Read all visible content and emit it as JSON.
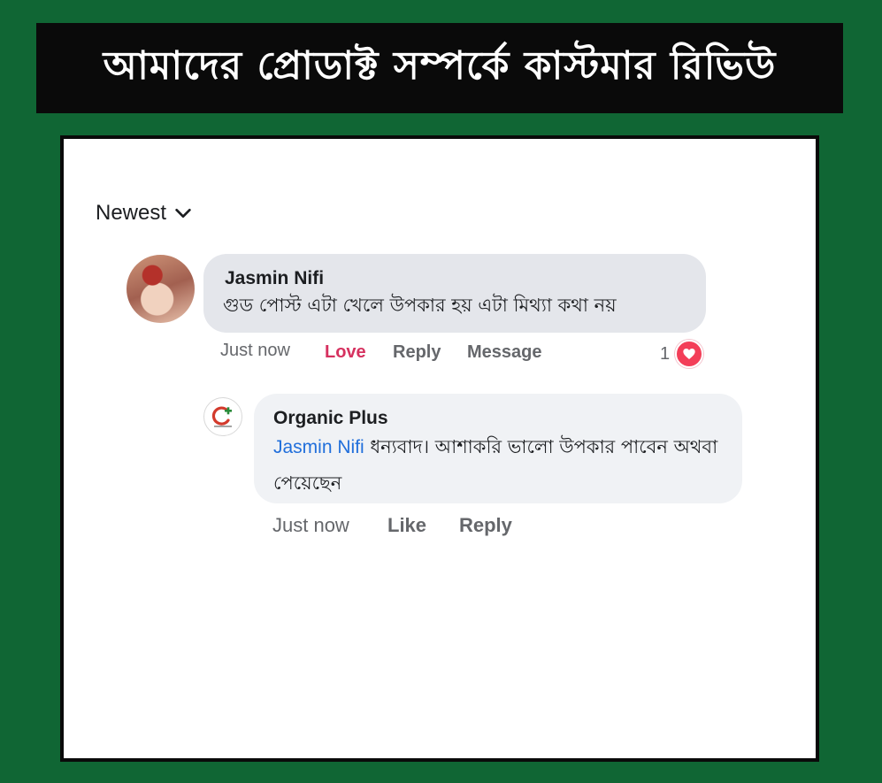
{
  "banner": {
    "title": "আমাদের প্রোডাক্ট সম্পর্কে কাস্টমার রিভিউ"
  },
  "sort": {
    "label": "Newest",
    "icon": "chevron-down-icon"
  },
  "comment": {
    "author": "Jasmin Nifi",
    "text": "গুড পোস্ট এটা খেলে উপকার হয় এটা মিথ্যা কথা নয়",
    "time": "Just now",
    "love_label": "Love",
    "reply_label": "Reply",
    "message_label": "Message",
    "reaction_count": "1",
    "reaction_icon": "heart-reaction-icon"
  },
  "reply": {
    "author": "Organic Plus",
    "mention": "Jasmin Nifi",
    "text": "ধন্যবাদ। আশাকরি ভালো উপকার পাবেন অথবা পেয়েছেন",
    "time": "Just now",
    "like_label": "Like",
    "reply_label": "Reply"
  },
  "colors": {
    "background": "#106634",
    "love": "#d6315f",
    "mention": "#216fdb",
    "heart": "#f33e58"
  }
}
